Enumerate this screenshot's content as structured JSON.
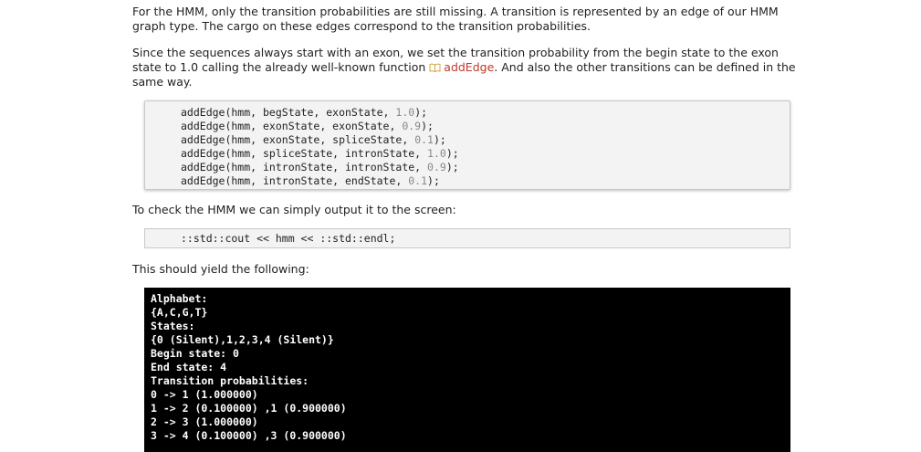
{
  "paragraphs": {
    "p1": "For the HMM, only the transition probabilities are still missing. A transition is represented by an edge of our HMM graph type. The cargo on these edges correspond to the transition probabilities.",
    "p2_before": "Since the sequences always start with an exon, we set the transition probability from the begin state to the exon state to 1.0 calling the already well-known function ",
    "p2_link": "addEdge",
    "p2_after": ". And also the other transitions can be defined in the same way.",
    "p3": "To check the HMM we can simply output it to the screen:",
    "p4": "This should yield the following:"
  },
  "code_block_1": {
    "lines": [
      {
        "code": "addEdge(hmm, begState, exonState, ",
        "num": "1.0",
        "end": ");"
      },
      {
        "code": "addEdge(hmm, exonState, exonState, ",
        "num": "0.9",
        "end": ");"
      },
      {
        "code": "addEdge(hmm, exonState, spliceState, ",
        "num": "0.1",
        "end": ");"
      },
      {
        "code": "addEdge(hmm, spliceState, intronState, ",
        "num": "1.0",
        "end": ");"
      },
      {
        "code": "addEdge(hmm, intronState, intronState, ",
        "num": "0.9",
        "end": ");"
      },
      {
        "code": "addEdge(hmm, intronState, endState, ",
        "num": "0.1",
        "end": ");"
      }
    ]
  },
  "code_block_2": {
    "line": "::std::cout << hmm << ::std::endl;"
  },
  "terminal_output": {
    "lines": [
      "Alphabet:",
      "{A,C,G,T}",
      "States:",
      "{0 (Silent),1,2,3,4 (Silent)}",
      "Begin state: 0",
      "End state: 4",
      "Transition probabilities:",
      "0 -> 1 (1.000000)",
      "1 -> 2 (0.100000) ,1 (0.900000)",
      "2 -> 3 (1.000000)",
      "3 -> 4 (0.100000) ,3 (0.900000)"
    ]
  },
  "icons": {
    "link_icon": "book-icon"
  },
  "colors": {
    "link": "#c0392b",
    "terminal_bg": "#000000",
    "code_bg": "#f3f3f3",
    "number": "#888888"
  }
}
